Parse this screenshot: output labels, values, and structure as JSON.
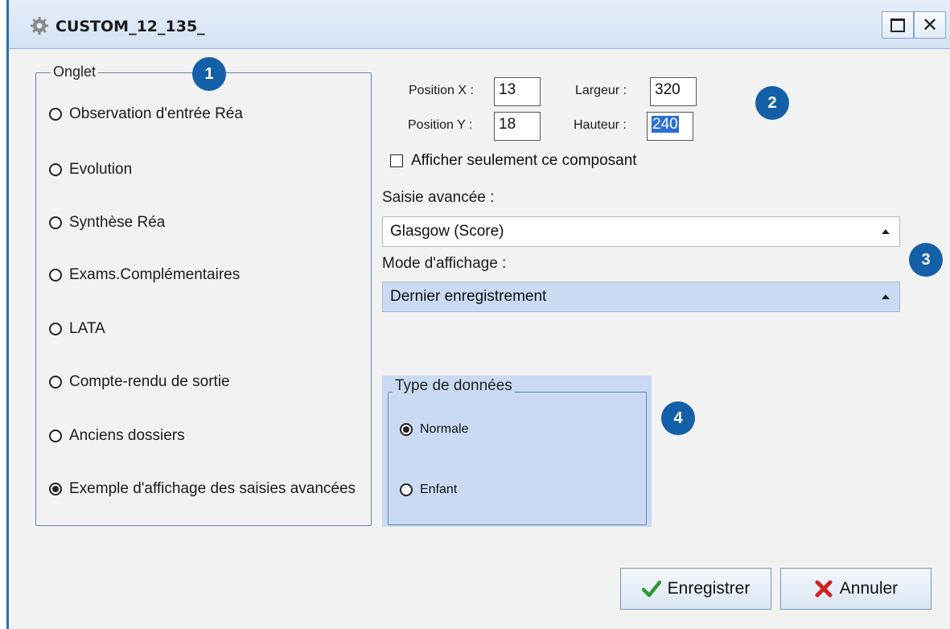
{
  "window": {
    "title": "CUSTOM_12_135_",
    "icon": "gear-icon",
    "close_glyph": "✕"
  },
  "onglet": {
    "legend": "Onglet",
    "badge": "1",
    "options": [
      {
        "label": "Observation d'entrée Réa",
        "selected": false
      },
      {
        "label": "Evolution",
        "selected": false
      },
      {
        "label": "Synthèse Réa",
        "selected": false
      },
      {
        "label": "Exams.Complémentaires",
        "selected": false
      },
      {
        "label": "LATA",
        "selected": false
      },
      {
        "label": "Compte-rendu de sortie",
        "selected": false
      },
      {
        "label": "Anciens dossiers",
        "selected": false
      },
      {
        "label": "Exemple d'affichage des saisies avancées",
        "selected": true
      }
    ]
  },
  "position": {
    "badge": "2",
    "x_label": "Position X :",
    "x_value": "13",
    "y_label": "Position Y :",
    "y_value": "18",
    "width_label": "Largeur :",
    "width_value": "320",
    "height_label": "Hauteur :",
    "height_value": "240"
  },
  "only_component": {
    "label": "Afficher seulement ce composant",
    "checked": false
  },
  "advanced": {
    "badge": "3",
    "saisie_label": "Saisie avancée :",
    "saisie_value": "Glasgow (Score)",
    "mode_label": "Mode d'affichage :",
    "mode_value": "Dernier enregistrement"
  },
  "data_type": {
    "badge": "4",
    "legend": "Type de données",
    "options": [
      {
        "label": "Normale",
        "selected": true
      },
      {
        "label": "Enfant",
        "selected": false
      }
    ]
  },
  "buttons": {
    "save": "Enregistrer",
    "cancel": "Annuler"
  },
  "colors": {
    "accent": "#1460a8",
    "panel": "#c9daf2",
    "save_icon": "#2e9b2e",
    "cancel_icon": "#d42020"
  }
}
